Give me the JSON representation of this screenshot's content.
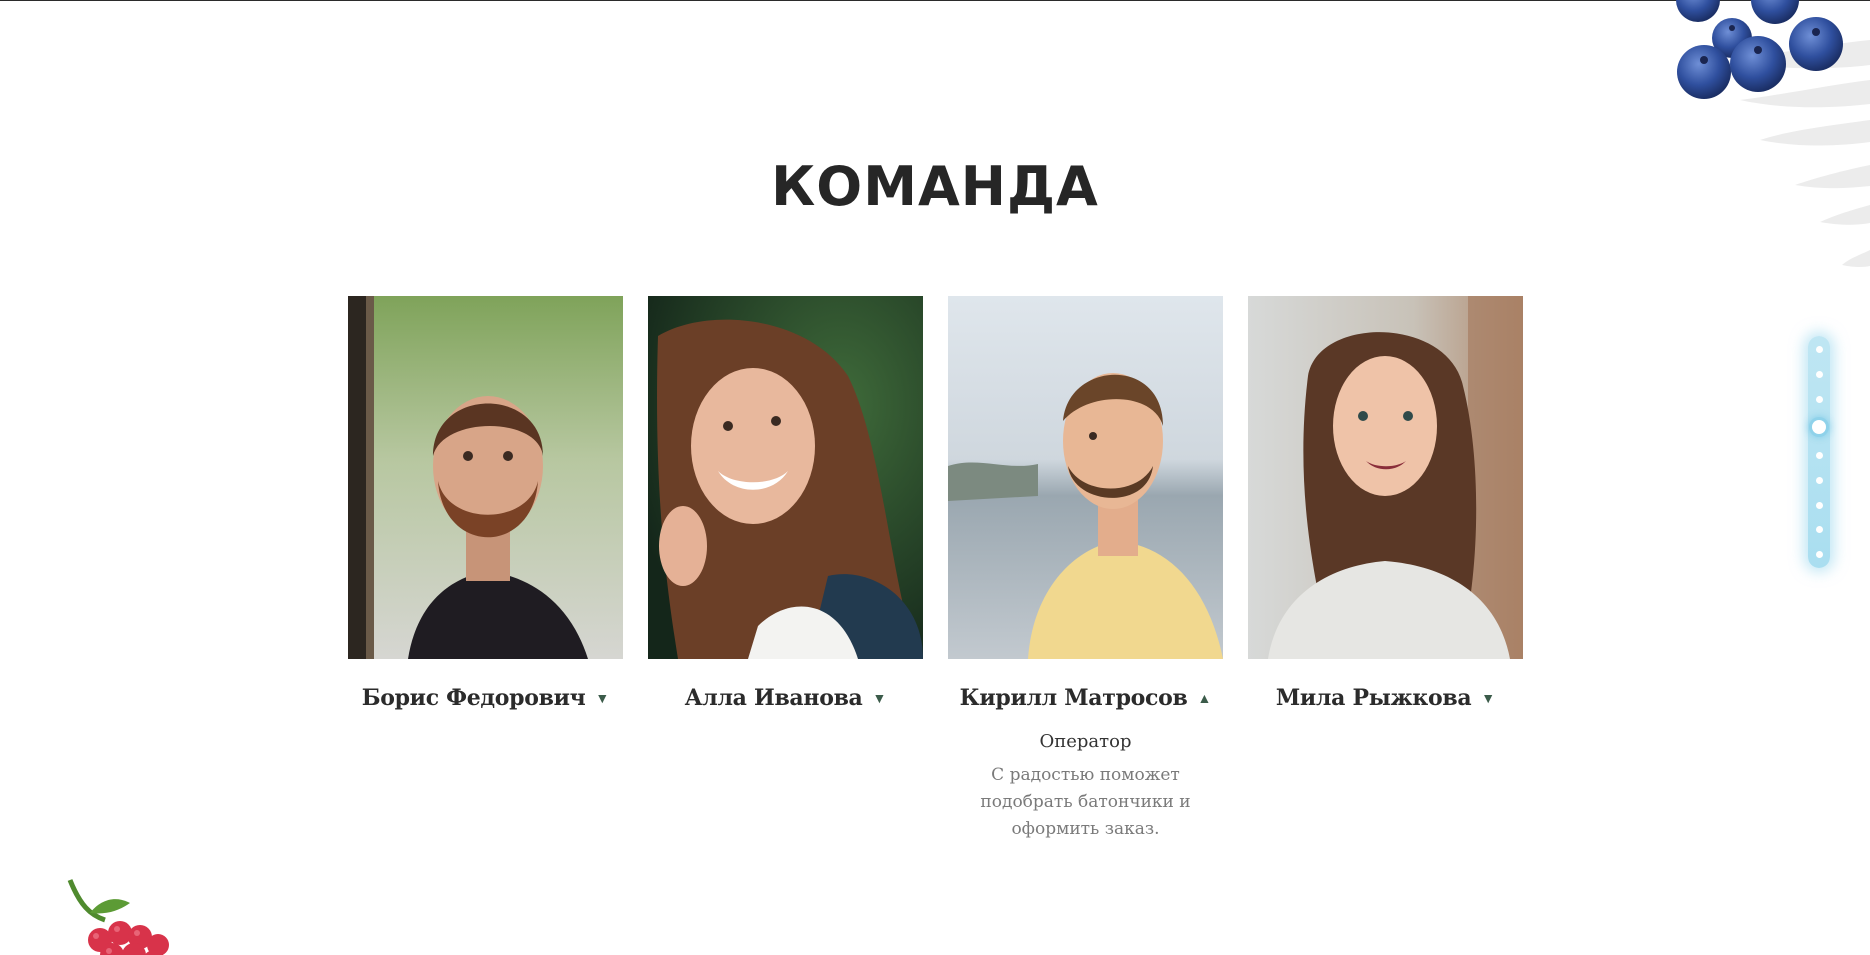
{
  "section": {
    "title": "КОМАНДА"
  },
  "team": [
    {
      "name": "Борис Федорович",
      "expanded": false,
      "toggle_icon": "▼",
      "icon": "caret-down-icon"
    },
    {
      "name": "Алла Иванова",
      "expanded": false,
      "toggle_icon": "▼",
      "icon": "caret-down-icon"
    },
    {
      "name": "Кирилл Матросов",
      "expanded": true,
      "toggle_icon": "▲",
      "icon": "caret-up-icon",
      "role": "Оператор",
      "description": "С радостью поможет подобрать батончики и оформить заказ."
    },
    {
      "name": "Мила Рыжкова",
      "expanded": false,
      "toggle_icon": "▼",
      "icon": "caret-down-icon"
    }
  ],
  "dot_nav": {
    "count": 9,
    "active_index": 3
  },
  "colors": {
    "title": "#262626",
    "accent_caret": "#3b5b4a",
    "nav_glow": "#a9def0",
    "description_text": "#7a7a7a"
  }
}
